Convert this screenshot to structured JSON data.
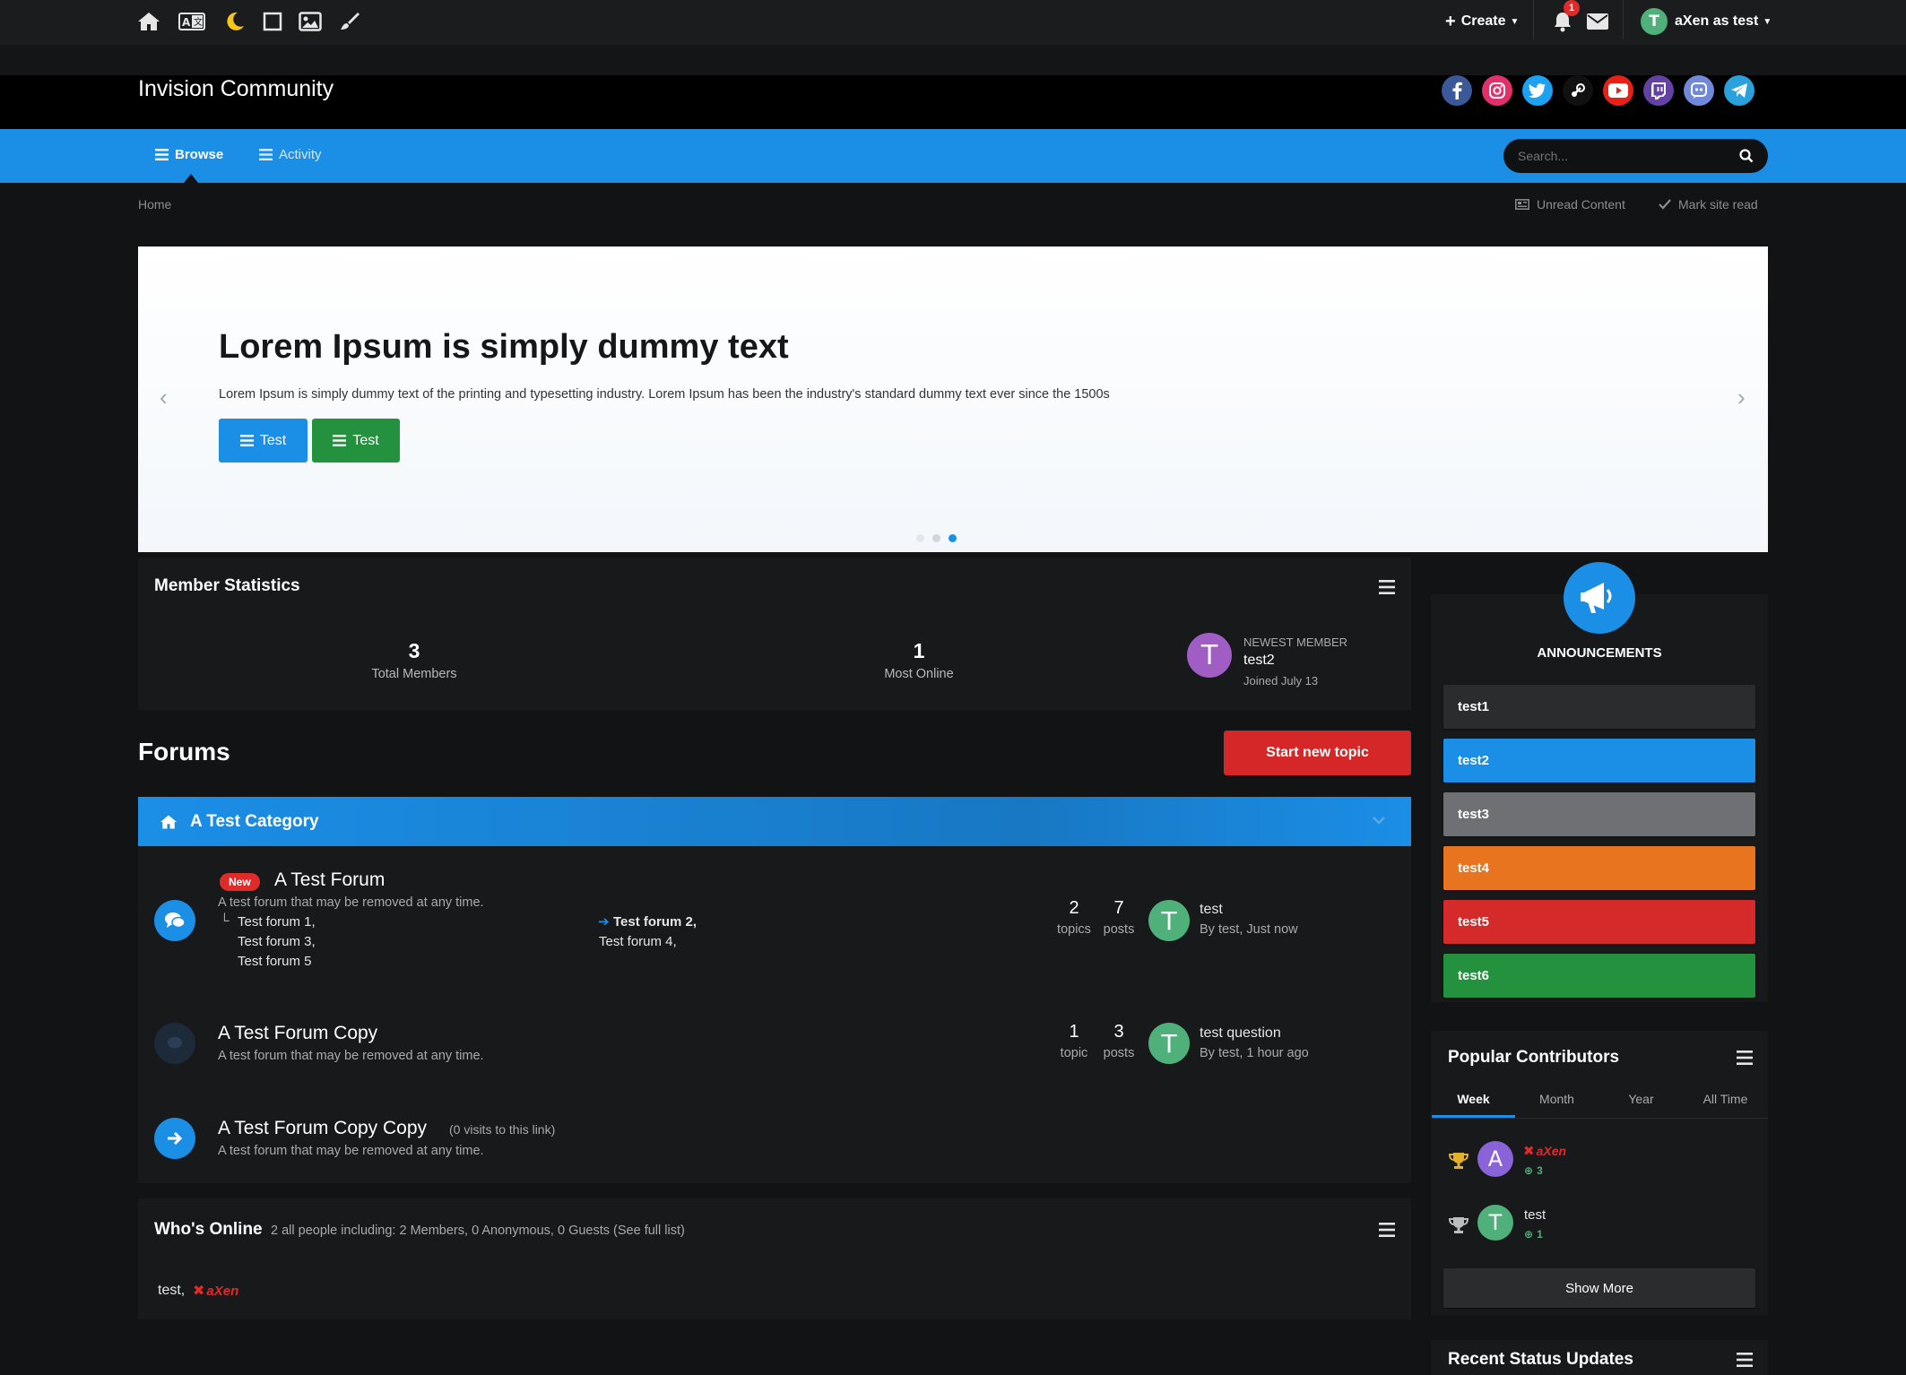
{
  "topbar": {
    "icons": [
      "home-icon",
      "translate-icon",
      "moon-icon",
      "square-icon",
      "image-icon",
      "brush-icon"
    ],
    "create_label": "Create",
    "notification_count": "1",
    "user_initial": "T",
    "user_label": "aXen as test"
  },
  "header": {
    "site_title": "Invision Community",
    "social": [
      "facebook",
      "instagram",
      "twitter",
      "steam",
      "youtube",
      "twitch",
      "discord",
      "telegram"
    ]
  },
  "nav": {
    "browse_label": "Browse",
    "activity_label": "Activity",
    "search_placeholder": "Search..."
  },
  "breadcrumb": {
    "home": "Home",
    "unread": "Unread Content",
    "mark_read": "Mark site read"
  },
  "slider": {
    "title": "Lorem Ipsum is simply dummy text",
    "text": "Lorem Ipsum is simply dummy text of the printing and typesetting industry. Lorem Ipsum has been the industry's standard dummy text ever since the 1500s",
    "button1": "Test",
    "button2": "Test",
    "prev": "‹",
    "next": "›"
  },
  "member_stats": {
    "title": "Member Statistics",
    "total_members": "3",
    "total_members_label": "Total Members",
    "most_online": "1",
    "most_online_label": "Most Online",
    "newest_label": "NEWEST MEMBER",
    "newest_initial": "T",
    "newest_name": "test2",
    "newest_joined": "Joined July 13"
  },
  "forums": {
    "title": "Forums",
    "start_topic": "Start new topic",
    "category": "A Test Category",
    "items": [
      {
        "badge": "New",
        "title": "A Test Forum",
        "desc": "A test forum that may be removed at any time.",
        "sub1": "Test forum 1,",
        "sub2": "Test forum 3,",
        "sub3": "Test forum 5",
        "sub4": "Test forum 2,",
        "sub5": "Test forum 4,",
        "topics": "2",
        "topics_label": "topics",
        "posts": "7",
        "posts_label": "posts",
        "last_initial": "T",
        "last_title": "test",
        "last_meta": "By test, Just now"
      },
      {
        "title": "A Test Forum Copy",
        "desc": "A test forum that may be removed at any time.",
        "topics": "1",
        "topics_label": "topic",
        "posts": "3",
        "posts_label": "posts",
        "last_initial": "T",
        "last_title": "test question",
        "last_meta": "By test, 1 hour ago"
      },
      {
        "title": "A Test Forum Copy Copy",
        "visits": "(0 visits to this link)",
        "desc": "A test forum that may be removed at any time."
      }
    ]
  },
  "whos_online": {
    "title": "Who's Online",
    "summary": "2 all people including: 2 Members, 0 Anonymous, 0 Guests (See full list)",
    "user1": "test,",
    "user2": "aXen"
  },
  "announcements": {
    "title": "ANNOUNCEMENTS",
    "items": [
      {
        "label": "test1",
        "color": "#2b2c2e"
      },
      {
        "label": "test2",
        "color": "#1b8ee6"
      },
      {
        "label": "test3",
        "color": "#6f7073"
      },
      {
        "label": "test4",
        "color": "#e8741f"
      },
      {
        "label": "test5",
        "color": "#d52a2a"
      },
      {
        "label": "test6",
        "color": "#24913e"
      }
    ]
  },
  "popular": {
    "title": "Popular Contributors",
    "tabs": [
      "Week",
      "Month",
      "Year",
      "All Time"
    ],
    "users": [
      {
        "initial": "A",
        "name": "aXen",
        "rep": "3"
      },
      {
        "initial": "T",
        "name": "test",
        "rep": "1"
      }
    ],
    "show_more": "Show More"
  },
  "recent_status": {
    "title": "Recent Status Updates"
  },
  "colors": {
    "accent": "#1b8ee6",
    "danger": "#d52727",
    "success": "#24913e",
    "avatar_green": "#4fb07a",
    "avatar_purple": "#a05ec4"
  }
}
